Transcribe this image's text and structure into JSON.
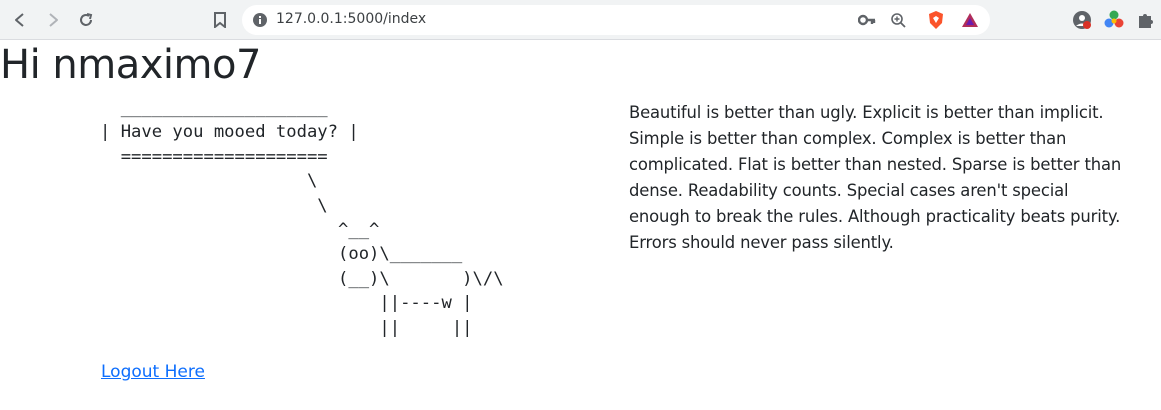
{
  "browser": {
    "url": "127.0.0.1:5000/index"
  },
  "page": {
    "greeting": "Hi nmaximo7",
    "cowsay": [
      "  ____________________",
      "| Have you mooed today? |",
      "  ====================",
      "                    \\",
      "                     \\",
      "                       ^__^",
      "                       (oo)\\_______",
      "                       (__)\\       )\\/\\",
      "                           ||----w |",
      "                           ||     ||"
    ],
    "zen_text": "Beautiful is better than ugly. Explicit is better than implicit. Simple is better than complex. Complex is better than complicated. Flat is better than nested. Sparse is better than dense. Readability counts. Special cases aren't special enough to break the rules. Although practicality beats purity. Errors should never pass silently.",
    "logout_label": "Logout Here"
  },
  "colors": {
    "link": "#0d6efd",
    "brave": "#fb542b"
  }
}
